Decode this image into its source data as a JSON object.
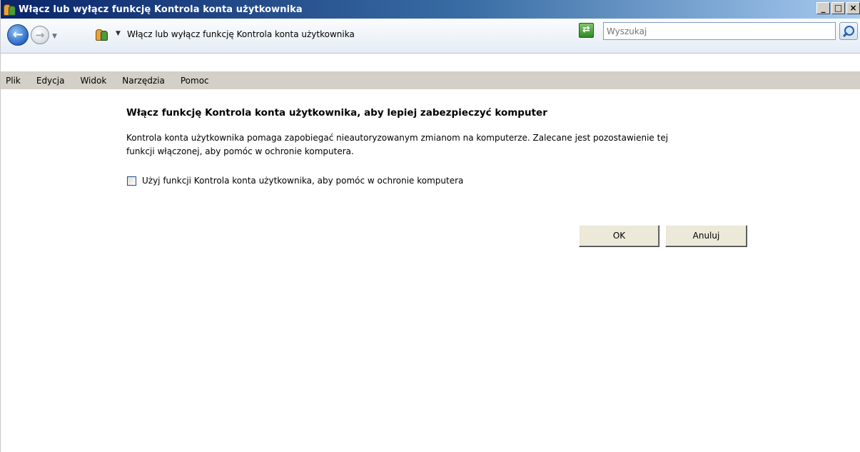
{
  "window": {
    "title": "Włącz lub wyłącz funkcję Kontrola konta użytkownika",
    "icon": "user-accounts-icon"
  },
  "nav": {
    "address_text": "Włącz lub wyłącz funkcję Kontrola konta użytkownika",
    "search_placeholder": "Wyszukaj"
  },
  "menu": {
    "items": [
      "Plik",
      "Edycja",
      "Widok",
      "Narzędzia",
      "Pomoc"
    ]
  },
  "content": {
    "heading": "Włącz funkcję Kontrola konta użytkownika, aby lepiej zabezpieczyć komputer",
    "description": "Kontrola konta użytkownika pomaga zapobiegać nieautoryzowanym zmianom na komputerze. Zalecane jest pozostawienie tej funkcji włączonej, aby pomóc w ochronie komputera.",
    "checkbox_label": "Użyj funkcji Kontrola konta użytkownika, aby pomóc w ochronie komputera",
    "checkbox_checked": false,
    "ok_label": "OK",
    "cancel_label": "Anuluj"
  }
}
